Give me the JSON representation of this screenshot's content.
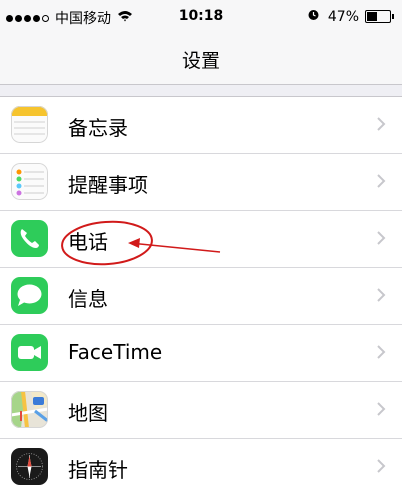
{
  "status_bar": {
    "signal_bars_filled": 4,
    "signal_bars_total": 5,
    "carrier": "中国移动",
    "time": "10:18",
    "battery": "47%",
    "battery_level": 0.47
  },
  "nav": {
    "title": "设置"
  },
  "rows": [
    {
      "label": "备忘录",
      "icon": "notes-icon"
    },
    {
      "label": "提醒事项",
      "icon": "reminders-icon"
    },
    {
      "label": "电话",
      "icon": "phone-icon"
    },
    {
      "label": "信息",
      "icon": "messages-icon"
    },
    {
      "label": "FaceTime",
      "icon": "facetime-icon"
    },
    {
      "label": "地图",
      "icon": "maps-icon"
    },
    {
      "label": "指南针",
      "icon": "compass-icon"
    }
  ],
  "annotation": {
    "color": "#d11a1a",
    "target": "电话"
  }
}
